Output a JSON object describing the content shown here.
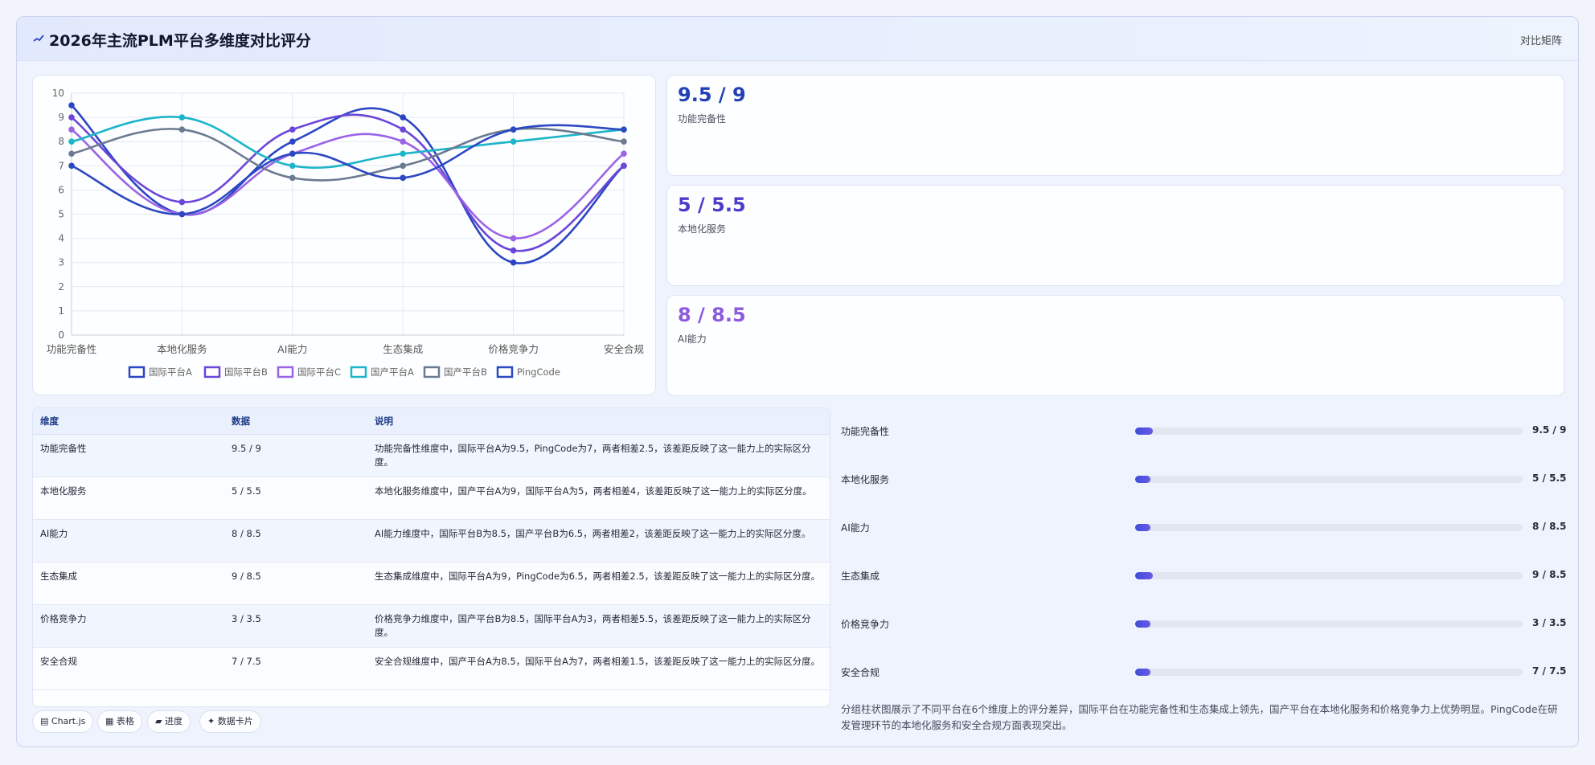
{
  "header": {
    "title": "2026年主流PLM平台多维度对比评分",
    "tag": "对比矩阵"
  },
  "colors": {
    "accent": "#2643b8",
    "series": [
      "#2b45c4",
      "#6b46d8",
      "#9b63e6",
      "#1cb5c9",
      "#6b7a8f",
      "#2c48c2"
    ]
  },
  "chart_data": {
    "type": "line",
    "categories": [
      "功能完备性",
      "本地化服务",
      "AI能力",
      "生态集成",
      "价格竞争力",
      "安全合规"
    ],
    "ylim": [
      0,
      10
    ],
    "yticks": [
      "0",
      "1",
      "2",
      "3",
      "4",
      "5",
      "6",
      "7",
      "8",
      "9",
      "10"
    ],
    "grid": true,
    "legend_position": "bottom",
    "series": [
      {
        "name": "国际平台A",
        "values": [
          9.5,
          5,
          8,
          9,
          3,
          7
        ]
      },
      {
        "name": "国际平台B",
        "values": [
          9,
          5.5,
          8.5,
          8.5,
          3.5,
          7
        ]
      },
      {
        "name": "国际平台C",
        "values": [
          8.5,
          5,
          7.5,
          8,
          4,
          7.5
        ]
      },
      {
        "name": "国产平台A",
        "values": [
          8,
          9,
          7,
          7.5,
          8,
          8.5
        ]
      },
      {
        "name": "国产平台B",
        "values": [
          7.5,
          8.5,
          6.5,
          7,
          8.5,
          8
        ]
      },
      {
        "name": "PingCode",
        "values": [
          7,
          5,
          7.5,
          6.5,
          8.5,
          8.5
        ]
      }
    ]
  },
  "stats": [
    {
      "value": "9.5 / 9",
      "label": "功能完备性",
      "color": "#2340b6"
    },
    {
      "value": "5 / 5.5",
      "label": "本地化服务",
      "color": "#4a3ec9"
    },
    {
      "value": "8 / 8.5",
      "label": "AI能力",
      "color": "#8b5bdc"
    }
  ],
  "table": {
    "headers": [
      "维度",
      "数据",
      "说明"
    ],
    "rows": [
      {
        "dim": "功能完备性",
        "data": "9.5 / 9",
        "desc": "功能完备性维度中，国际平台A为9.5，PingCode为7，两者相差2.5，该差距反映了这一能力上的实际区分度。"
      },
      {
        "dim": "本地化服务",
        "data": "5 / 5.5",
        "desc": "本地化服务维度中，国产平台A为9，国际平台A为5，两者相差4，该差距反映了这一能力上的实际区分度。"
      },
      {
        "dim": "AI能力",
        "data": "8 / 8.5",
        "desc": "AI能力维度中，国际平台B为8.5，国产平台B为6.5，两者相差2，该差距反映了这一能力上的实际区分度。"
      },
      {
        "dim": "生态集成",
        "data": "9 / 8.5",
        "desc": "生态集成维度中，国际平台A为9，PingCode为6.5，两者相差2.5，该差距反映了这一能力上的实际区分度。"
      },
      {
        "dim": "价格竞争力",
        "data": "3 / 3.5",
        "desc": "价格竞争力维度中，国产平台B为8.5，国际平台A为3，两者相差5.5，该差距反映了这一能力上的实际区分度。"
      },
      {
        "dim": "安全合规",
        "data": "7 / 7.5",
        "desc": "安全合规维度中，国产平台A为8.5，国际平台A为7，两者相差1.5，该差距反映了这一能力上的实际区分度。"
      }
    ]
  },
  "progress": [
    {
      "label": "功能完备性",
      "value": "9.5 / 9",
      "fraction": 0.045
    },
    {
      "label": "本地化服务",
      "value": "5 / 5.5",
      "fraction": 0.04
    },
    {
      "label": "AI能力",
      "value": "8 / 8.5",
      "fraction": 0.04
    },
    {
      "label": "生态集成",
      "value": "9 / 8.5",
      "fraction": 0.045
    },
    {
      "label": "价格竞争力",
      "value": "3 / 3.5",
      "fraction": 0.04
    },
    {
      "label": "安全合规",
      "value": "7 / 7.5",
      "fraction": 0.04
    }
  ],
  "note": "分组柱状图展示了不同平台在6个维度上的评分差异，国际平台在功能完备性和生态集成上领先，国产平台在本地化服务和价格竞争力上优势明显。PingCode在研发管理环节的本地化服务和安全合规方面表现突出。",
  "chips": [
    {
      "label": "▤ Chart.js",
      "icon": "chart-icon"
    },
    {
      "label": "▦ 表格",
      "icon": "table-icon"
    },
    {
      "label": "▰ 进度",
      "icon": "progress-icon"
    },
    {
      "label": "✦ 数据卡片",
      "icon": "card-icon"
    }
  ]
}
